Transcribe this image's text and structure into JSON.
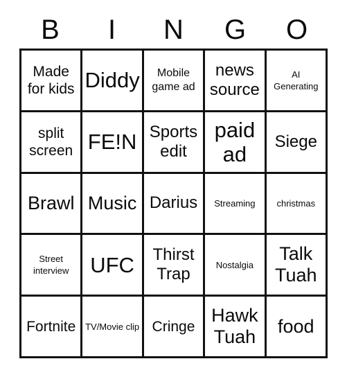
{
  "card": {
    "header_letters": [
      "B",
      "I",
      "N",
      "G",
      "O"
    ],
    "colors": {
      "border": "#111111",
      "background": "#ffffff",
      "text": "#0a0a0a"
    },
    "rows": [
      [
        {
          "text": "Made for kids",
          "size": "md"
        },
        {
          "text": "Diddy",
          "size": "xxl"
        },
        {
          "text": "Mobile game ad",
          "size": "sm"
        },
        {
          "text": "news source",
          "size": "lg"
        },
        {
          "text": "AI Generating",
          "size": "xs"
        }
      ],
      [
        {
          "text": "split screen",
          "size": "md"
        },
        {
          "text": "FE!N",
          "size": "xxl"
        },
        {
          "text": "Sports edit",
          "size": "lg"
        },
        {
          "text": "paid ad",
          "size": "xxl"
        },
        {
          "text": "Siege",
          "size": "lg"
        }
      ],
      [
        {
          "text": "Brawl",
          "size": "xl"
        },
        {
          "text": "Music",
          "size": "xl"
        },
        {
          "text": "Darius",
          "size": "lg"
        },
        {
          "text": "Streaming",
          "size": "xs"
        },
        {
          "text": "christmas",
          "size": "xs"
        }
      ],
      [
        {
          "text": "Street interview",
          "size": "xs"
        },
        {
          "text": "UFC",
          "size": "xxl"
        },
        {
          "text": "Thirst Trap",
          "size": "lg"
        },
        {
          "text": "Nostalgia",
          "size": "xs"
        },
        {
          "text": "Talk Tuah",
          "size": "xl"
        }
      ],
      [
        {
          "text": "Fortnite",
          "size": "md"
        },
        {
          "text": "TV/Movie clip",
          "size": "xs"
        },
        {
          "text": "Cringe",
          "size": "md"
        },
        {
          "text": "Hawk Tuah",
          "size": "xl"
        },
        {
          "text": "food",
          "size": "xl"
        }
      ]
    ]
  }
}
